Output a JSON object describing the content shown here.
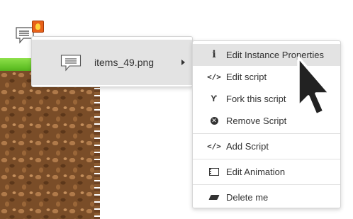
{
  "submenu_parent": {
    "icon": "speech-bubble-icon",
    "label": "items_49.png"
  },
  "menu": {
    "items": [
      {
        "icon": "info-icon",
        "glyph": "i",
        "label": "Edit Instance Properties"
      },
      {
        "icon": "code-icon",
        "glyph": "</>",
        "label": "Edit script"
      },
      {
        "icon": "fork-icon",
        "glyph": "Ƴ",
        "label": "Fork this script"
      },
      {
        "icon": "remove-icon",
        "glyph": "✕",
        "label": "Remove Script"
      },
      {
        "icon": "code-icon",
        "glyph": "</>",
        "label": "Add Script"
      },
      {
        "icon": "film-icon",
        "glyph": "",
        "label": "Edit Animation"
      },
      {
        "icon": "eraser-icon",
        "glyph": "",
        "label": "Delete me"
      }
    ]
  }
}
